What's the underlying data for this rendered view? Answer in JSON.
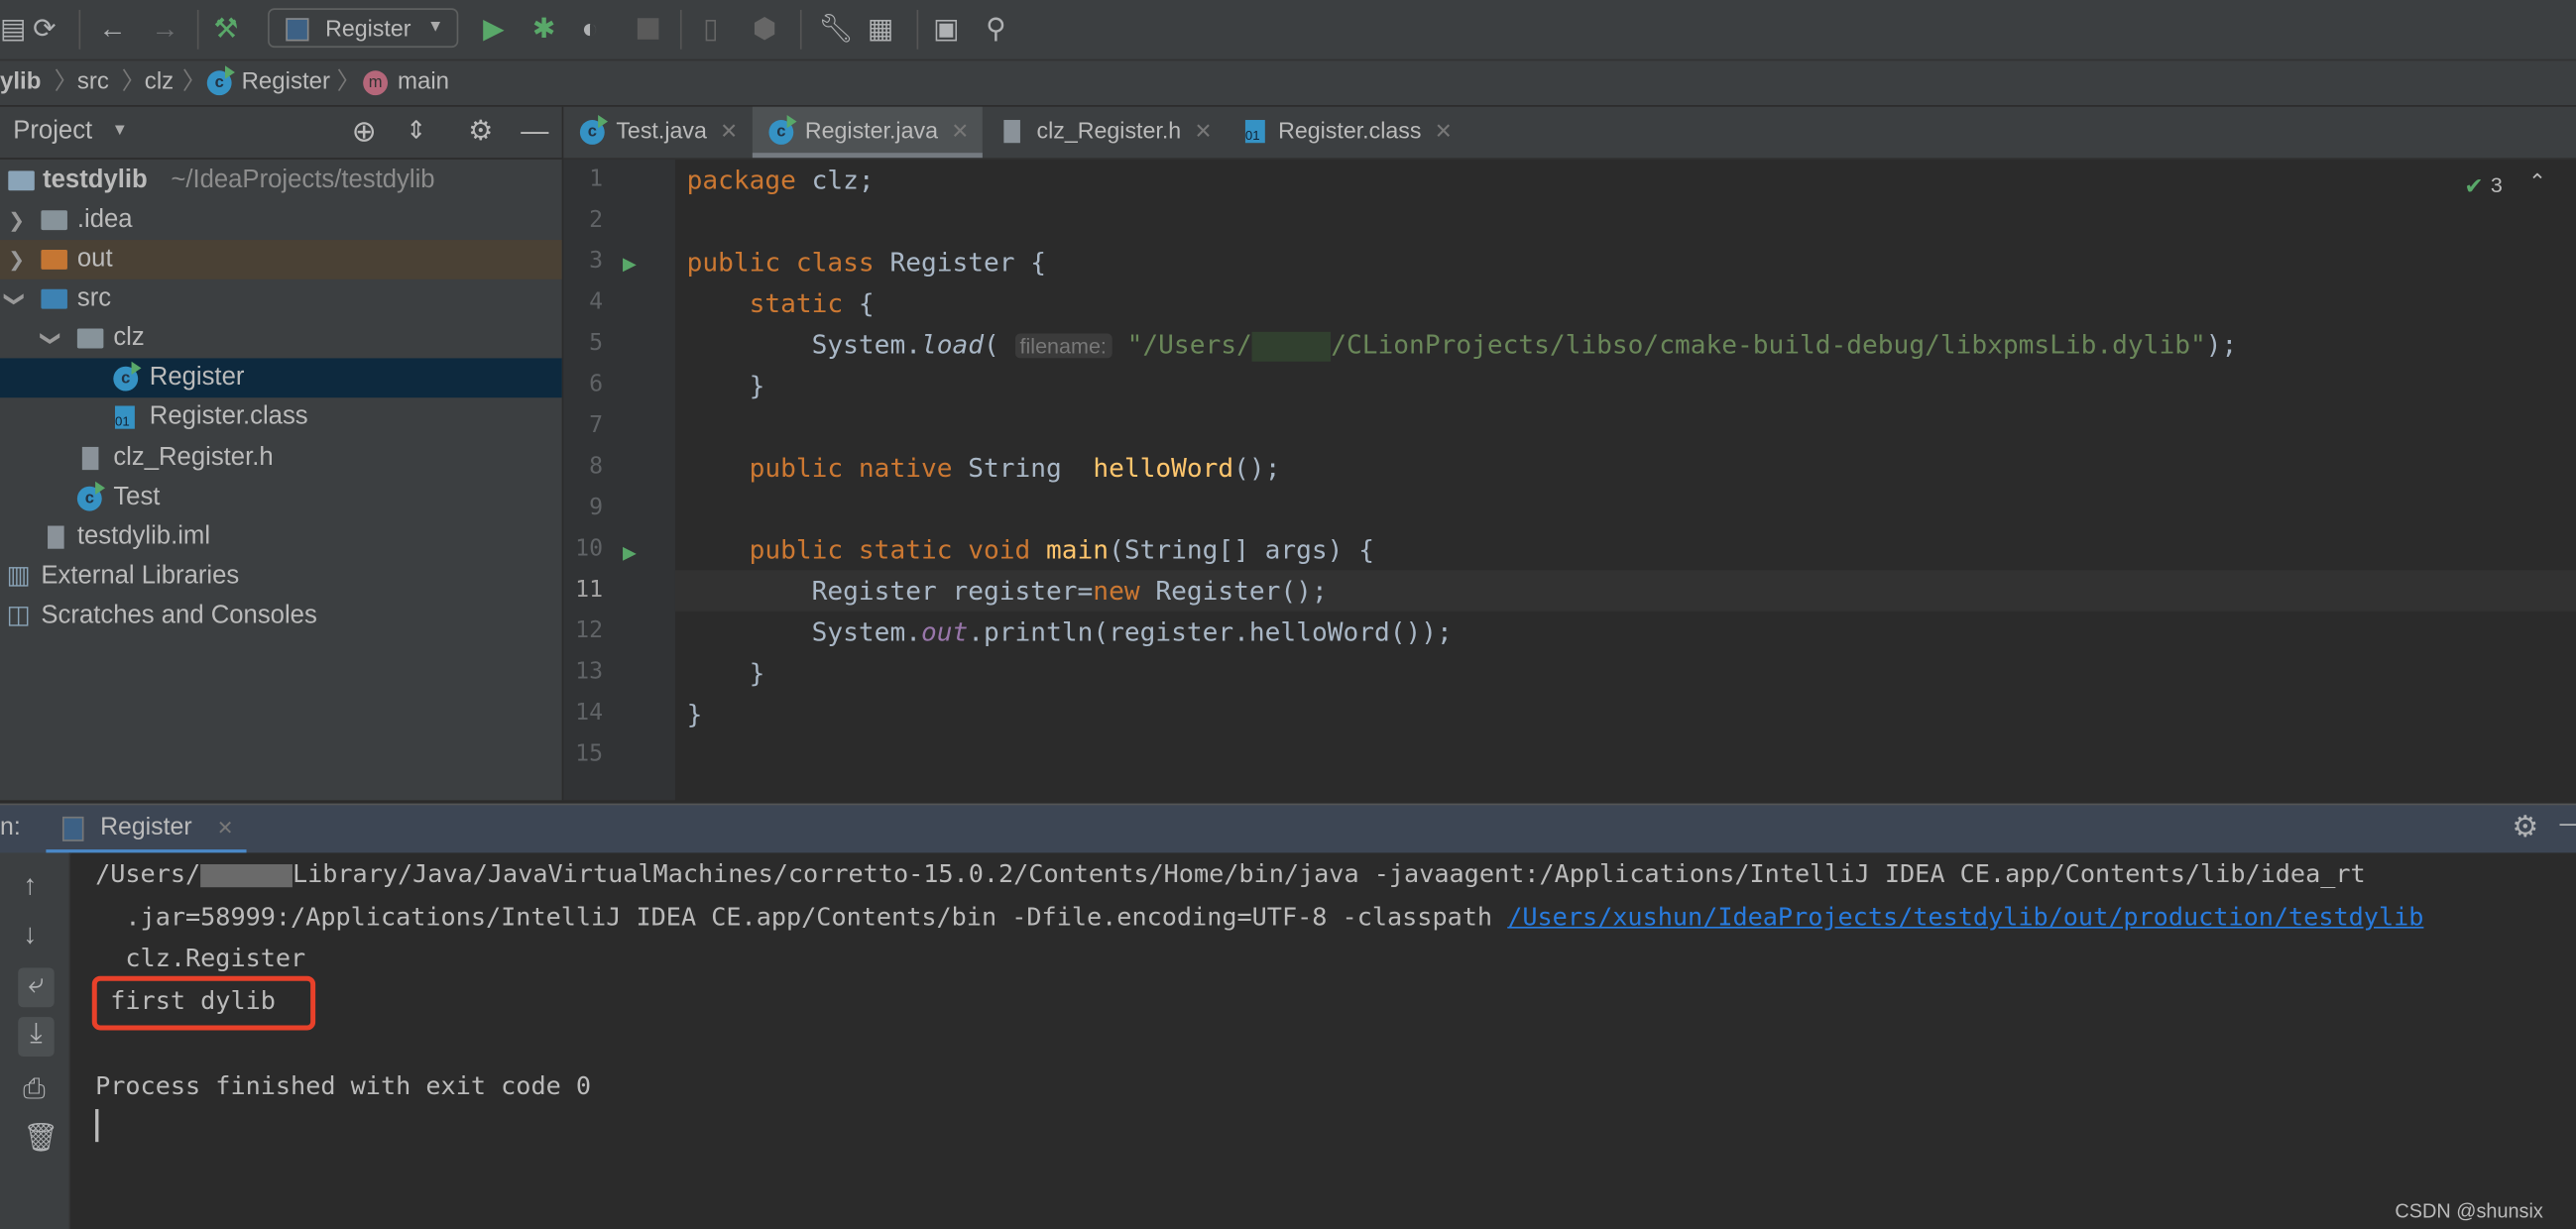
{
  "toolbar": {
    "run_config": "Register",
    "icons": [
      "save-icon",
      "sync-icon",
      "back-icon",
      "forward-icon",
      "build-icon",
      "run-icon",
      "debug-icon",
      "coverage-icon",
      "stop-icon",
      "device-icon",
      "deploy-icon",
      "settings-wrench-icon",
      "project-structure-icon",
      "terminal-icon",
      "search-icon"
    ]
  },
  "breadcrumb": [
    "ylib",
    "src",
    "clz",
    "Register",
    "main"
  ],
  "project_panel": {
    "title": "Project",
    "tree": [
      {
        "label": "testdylib",
        "hint": "~/IdeaProjects/testdylib"
      },
      {
        "label": ".idea"
      },
      {
        "label": "out"
      },
      {
        "label": "src"
      },
      {
        "label": "clz"
      },
      {
        "label": "Register"
      },
      {
        "label": "Register.class"
      },
      {
        "label": "clz_Register.h"
      },
      {
        "label": "Test"
      },
      {
        "label": "testdylib.iml"
      },
      {
        "label": "External Libraries"
      },
      {
        "label": "Scratches and Consoles"
      }
    ]
  },
  "tabs": [
    {
      "label": "Test.java"
    },
    {
      "label": "Register.java",
      "active": true
    },
    {
      "label": "clz_Register.h"
    },
    {
      "label": "Register.class"
    }
  ],
  "editor": {
    "inspection_count": "3",
    "line_numbers": [
      "1",
      "2",
      "3",
      "4",
      "5",
      "6",
      "7",
      "8",
      "9",
      "10",
      "11",
      "12",
      "13",
      "14",
      "15"
    ],
    "current_line": "11",
    "code": {
      "l1a": "package",
      "l1b": " clz;",
      "l3a": "public class",
      "l3b": " Register {",
      "l4a": "    static",
      "l4b": " {",
      "l5a": "        System.",
      "l5b": "load",
      "l5c": "(",
      "l5hint": "filename:",
      "l5d": "\"/Users/",
      "l5e": "/CLionProjects/libso/cmake-build-debug/libxpmsLib.dylib\"",
      "l5f": ");",
      "l6": "    }",
      "l8a": "    public native",
      "l8b": " String  ",
      "l8c": "helloWord",
      "l8d": "();",
      "l10a": "    public static void",
      "l10b": " main",
      "l10c": "(String[] args) {",
      "l11a": "        Register register=",
      "l11b": "new",
      "l11c": " Register();",
      "l12a": "        System.",
      "l12b": "out",
      "l12c": ".println(register.helloWord());",
      "l13": "    }",
      "l14": "}"
    }
  },
  "run_panel": {
    "prefix": "n:",
    "tab": "Register",
    "lines": {
      "l1a": "/Users/",
      "l1b": "Library/Java/JavaVirtualMachines/corretto-15.0.2/Contents/Home/bin/java -javaagent:/Applications/IntelliJ IDEA CE.app/Contents/lib/idea_rt",
      "l2a": "  .jar=58999:/Applications/IntelliJ IDEA CE.app/Contents/bin -Dfile.encoding=UTF-8 -classpath ",
      "l2link": "/Users/xushun/IdeaProjects/testdylib/out/production/testdylib",
      "l3": "  clz.Register",
      "l4": " first dylib",
      "l5": "Process finished with exit code 0"
    },
    "highlight_color": "#e8412a"
  },
  "watermark": "CSDN @shunsix"
}
